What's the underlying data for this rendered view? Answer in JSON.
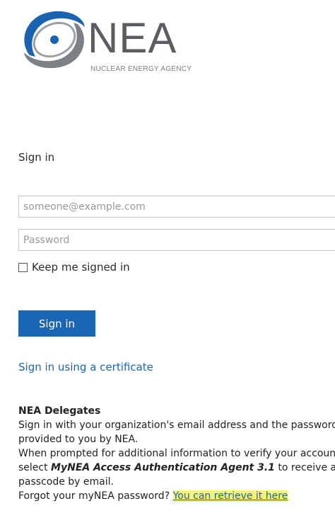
{
  "logo": {
    "name": "NEA",
    "subtitle": "NUCLEAR ENERGY AGENCY",
    "colors": {
      "blue": "#1a63b0",
      "gray": "#7c8186"
    }
  },
  "form": {
    "heading": "Sign in",
    "email_placeholder": "someone@example.com",
    "password_placeholder": "Password",
    "keep_signed_in_label": "Keep me signed in",
    "signin_button": "Sign in",
    "certificate_link": "Sign in using a certificate",
    "button_color": "#1a66b5"
  },
  "info": {
    "title": "NEA Delegates",
    "line1": "Sign in with your organization's email address and the password provided to you by NEA.",
    "line2_a": "When prompted for additional information to verify your account, select ",
    "line2_em": "MyNEA Access Authentication Agent 3.1",
    "line2_b": " to receive a passcode by email.",
    "line3_a": "Forgot your myNEA password? ",
    "line3_link": "You can retrieve it here"
  }
}
